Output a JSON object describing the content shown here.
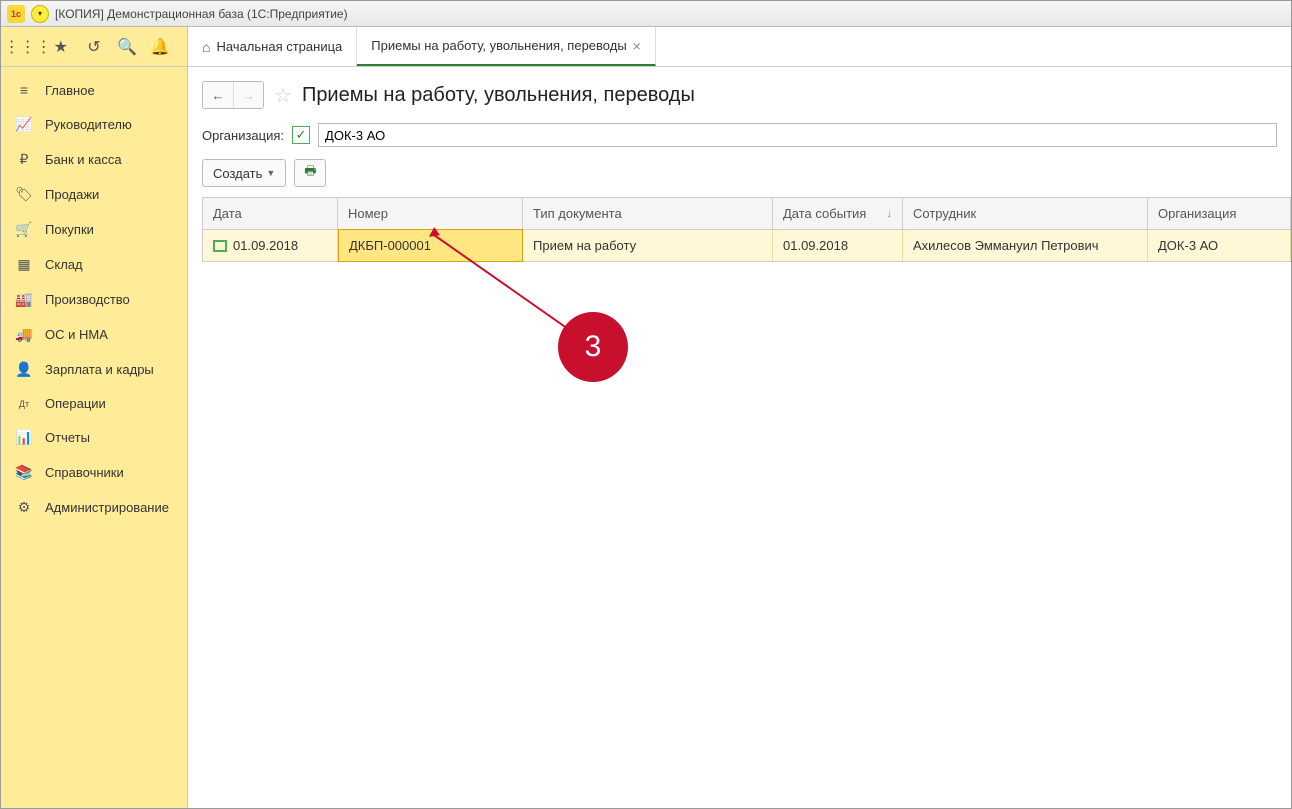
{
  "titlebar": {
    "title": "[КОПИЯ] Демонстрационная база  (1С:Предприятие)"
  },
  "tabs": {
    "home": "Начальная страница",
    "active": "Приемы на работу, увольнения, переводы"
  },
  "sidebar": {
    "items": [
      {
        "icon": "≡",
        "label": "Главное"
      },
      {
        "icon": "📈",
        "label": "Руководителю"
      },
      {
        "icon": "₽",
        "label": "Банк и касса"
      },
      {
        "icon": "🏷",
        "label": "Продажи"
      },
      {
        "icon": "🛒",
        "label": "Покупки"
      },
      {
        "icon": "▦",
        "label": "Склад"
      },
      {
        "icon": "🏭",
        "label": "Производство"
      },
      {
        "icon": "🚚",
        "label": "ОС и НМА"
      },
      {
        "icon": "👤",
        "label": "Зарплата и кадры"
      },
      {
        "icon": "Дт",
        "label": "Операции"
      },
      {
        "icon": "📊",
        "label": "Отчеты"
      },
      {
        "icon": "📚",
        "label": "Справочники"
      },
      {
        "icon": "⚙",
        "label": "Администрирование"
      }
    ]
  },
  "page": {
    "title": "Приемы на работу, увольнения, переводы"
  },
  "filter": {
    "label": "Организация:",
    "value": "ДОК-3 АО"
  },
  "toolbar": {
    "create": "Создать"
  },
  "table": {
    "headers": {
      "date": "Дата",
      "num": "Номер",
      "type": "Тип документа",
      "evdate": "Дата события",
      "emp": "Сотрудник",
      "org": "Организация"
    },
    "rows": [
      {
        "date": "01.09.2018",
        "num": "ДКБП-000001",
        "type": "Прием на работу",
        "evdate": "01.09.2018",
        "emp": "Ахилесов Эммануил Петрович",
        "org": "ДОК-3 АО"
      }
    ]
  },
  "annotation": {
    "number": "3"
  }
}
